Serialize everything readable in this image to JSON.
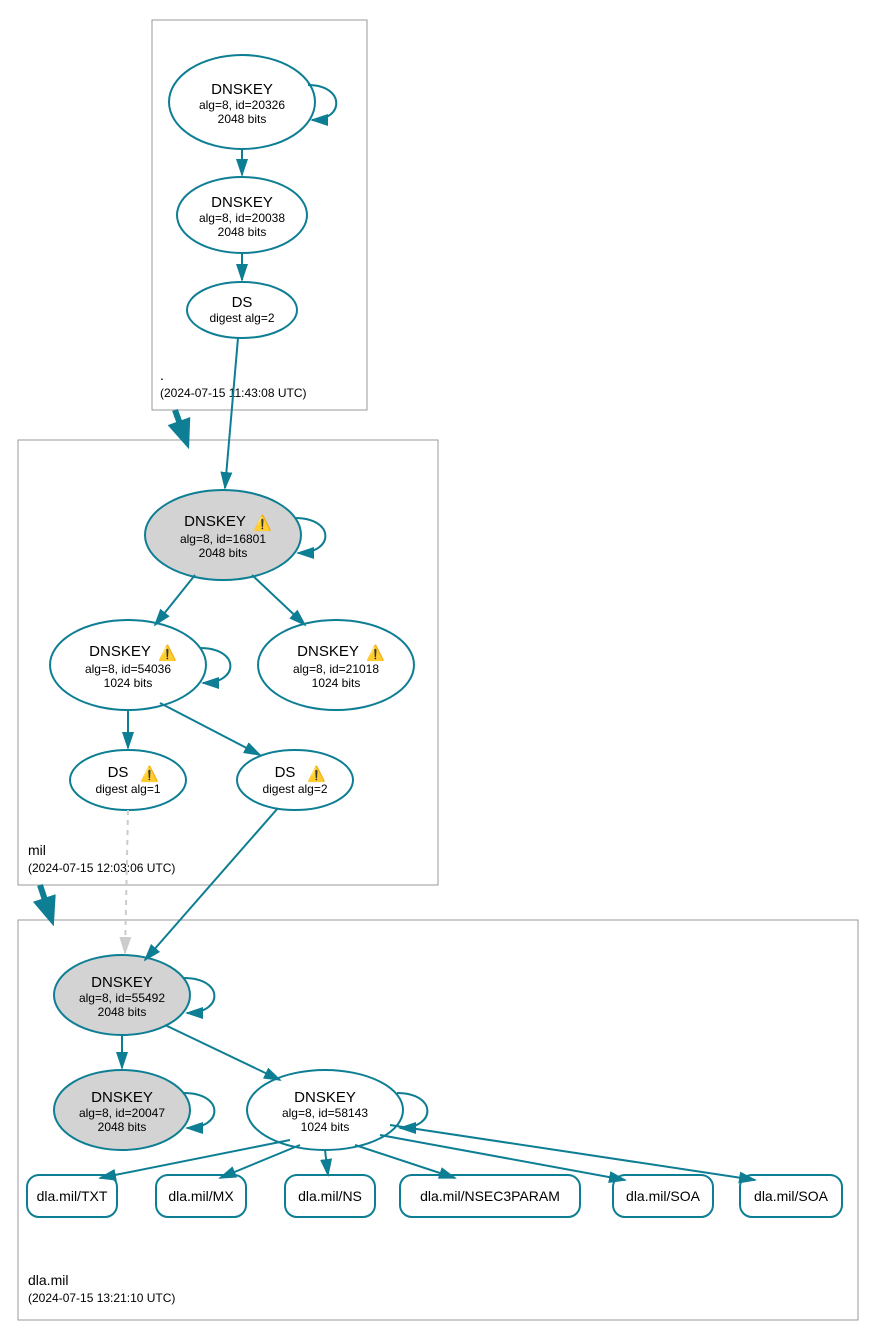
{
  "zones": {
    "root": {
      "name": ".",
      "timestamp": "(2024-07-15 11:43:08 UTC)"
    },
    "mil": {
      "name": "mil",
      "timestamp": "(2024-07-15 12:03:06 UTC)"
    },
    "dla": {
      "name": "dla.mil",
      "timestamp": "(2024-07-15 13:21:10 UTC)"
    }
  },
  "nodes": {
    "root_ksk": {
      "title": "DNSKEY",
      "line1": "alg=8, id=20326",
      "line2": "2048 bits"
    },
    "root_zsk": {
      "title": "DNSKEY",
      "line1": "alg=8, id=20038",
      "line2": "2048 bits"
    },
    "root_ds": {
      "title": "DS",
      "line1": "digest alg=2"
    },
    "mil_ksk": {
      "title": "DNSKEY",
      "line1": "alg=8, id=16801",
      "line2": "2048 bits",
      "warn": true
    },
    "mil_zsk1": {
      "title": "DNSKEY",
      "line1": "alg=8, id=54036",
      "line2": "1024 bits",
      "warn": true
    },
    "mil_zsk2": {
      "title": "DNSKEY",
      "line1": "alg=8, id=21018",
      "line2": "1024 bits",
      "warn": true
    },
    "mil_ds1": {
      "title": "DS",
      "line1": "digest alg=1",
      "warn": true
    },
    "mil_ds2": {
      "title": "DS",
      "line1": "digest alg=2",
      "warn": true
    },
    "dla_ksk": {
      "title": "DNSKEY",
      "line1": "alg=8, id=55492",
      "line2": "2048 bits"
    },
    "dla_key2": {
      "title": "DNSKEY",
      "line1": "alg=8, id=20047",
      "line2": "2048 bits"
    },
    "dla_zsk": {
      "title": "DNSKEY",
      "line1": "alg=8, id=58143",
      "line2": "1024 bits"
    }
  },
  "records": {
    "r1": "dla.mil/TXT",
    "r2": "dla.mil/MX",
    "r3": "dla.mil/NS",
    "r4": "dla.mil/NSEC3PARAM",
    "r5": "dla.mil/SOA",
    "r6": "dla.mil/SOA"
  },
  "icons": {
    "warning": "⚠️"
  }
}
